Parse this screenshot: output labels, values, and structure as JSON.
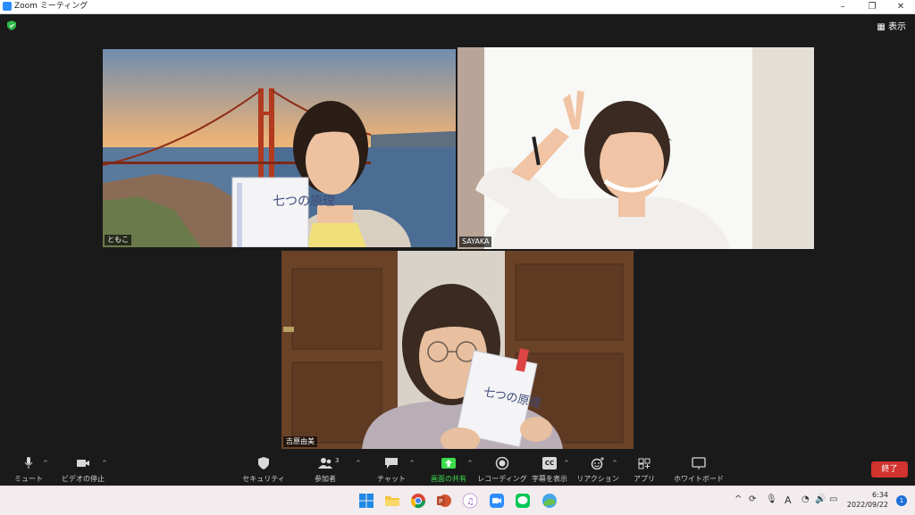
{
  "window": {
    "title": "Zoom ミーティング",
    "minimize": "–",
    "restore": "❐",
    "close": "✕"
  },
  "view_button": "表示",
  "participants": [
    {
      "name": "ともこ",
      "book_text": "七つの原理"
    },
    {
      "name": "SAYAKA"
    },
    {
      "name": "吉原由美",
      "book_text": "七つの原理"
    }
  ],
  "toolbar": {
    "mute": "ミュート",
    "video": "ビデオの停止",
    "security": "セキュリティ",
    "participants": "参加者",
    "participants_count": "3",
    "chat": "チャット",
    "share": "画面の共有",
    "record": "レコーディング",
    "captions": "字幕を表示",
    "reactions": "リアクション",
    "apps": "アプリ",
    "whiteboard": "ホワイトボード",
    "end": "終了",
    "cc_text": "CC"
  },
  "taskbar": {
    "time": "6:34",
    "date": "2022/09/22",
    "ime": "A",
    "notification_count": "1"
  },
  "colors": {
    "active_speaker": "#c6e86a",
    "share_green": "#3ddc4c",
    "end_red": "#d1332f",
    "security_green": "#2fb84a"
  }
}
